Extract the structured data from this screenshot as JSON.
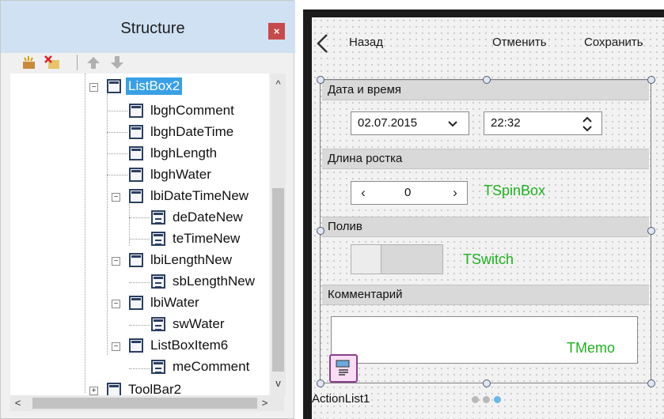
{
  "structure_panel": {
    "title": "Structure",
    "close_glyph": "×",
    "toolbar": [
      "add-item-icon",
      "delete-item-icon",
      "move-up-icon",
      "move-down-icon"
    ],
    "tree": [
      {
        "label": "ListBox2",
        "selected": true,
        "kind": "container"
      },
      {
        "label": "lbghComment",
        "kind": "item"
      },
      {
        "label": "lbghDateTime",
        "kind": "item"
      },
      {
        "label": "lbghLength",
        "kind": "item"
      },
      {
        "label": "lbghWater",
        "kind": "item"
      },
      {
        "label": "lbiDateTimeNew",
        "kind": "item"
      },
      {
        "label": "deDateNew",
        "kind": "control"
      },
      {
        "label": "teTimeNew",
        "kind": "control"
      },
      {
        "label": "lbiLengthNew",
        "kind": "item"
      },
      {
        "label": "sbLengthNew",
        "kind": "control"
      },
      {
        "label": "lbiWater",
        "kind": "item"
      },
      {
        "label": "swWater",
        "kind": "control"
      },
      {
        "label": "ListBoxItem6",
        "kind": "item"
      },
      {
        "label": "meComment",
        "kind": "control"
      },
      {
        "label": "ToolBar2",
        "kind": "container"
      }
    ],
    "scroll_up": "^",
    "scroll_down": "v",
    "scroll_left": "<",
    "scroll_right": ">"
  },
  "form": {
    "nav": {
      "back_label": "Назад",
      "cancel_label": "Отменить",
      "save_label": "Сохранить"
    },
    "groups": {
      "datetime_header": "Дата и время",
      "date_value": "02.07.2015",
      "time_value": "22:32",
      "length_header": "Длина ростка",
      "spin_value": "0",
      "spin_caption": "TSpinBox",
      "water_header": "Полив",
      "switch_caption": "TSwitch",
      "comment_header": "Комментарий",
      "memo_caption": "TMemo"
    },
    "action_list_label": "ActionList1",
    "accent_green": "#1fb21f",
    "selection_color": "#39a0e5"
  }
}
